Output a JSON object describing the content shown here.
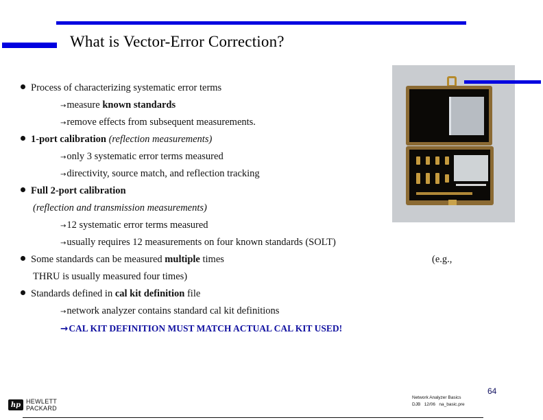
{
  "slide": {
    "title": "What is Vector-Error Correction?",
    "accent_color": "#0000e0",
    "emphasis_color": "#1010a0"
  },
  "bullets": [
    {
      "text": "Process of characterizing systematic error terms"
    },
    {
      "sub_prefix": "measure ",
      "sub_bold": "known standards"
    },
    {
      "text": "remove effects from subsequent measurements."
    },
    {
      "bold": "1-port calibration",
      "italic": " (reflection measurements)"
    },
    {
      "text": "only 3 systematic error terms measured"
    },
    {
      "text": "directivity, source match, and reflection tracking"
    },
    {
      "bold": "Full 2-port calibration"
    },
    {
      "italic": "(reflection and transmission measurements)"
    },
    {
      "text": "12 systematic error terms measured"
    },
    {
      "text": "usually requires 12 measurements on four known standards (SOLT)"
    },
    {
      "prefix": "Some standards can be measured ",
      "bold": "multiple",
      "suffix": " times"
    },
    {
      "text": "THRU is usually measured four times)"
    },
    {
      "prefix": "Standards defined in ",
      "bold": "cal kit definition",
      "suffix": " file"
    },
    {
      "text": "network analyzer contains standard cal kit definitions"
    },
    {
      "text": "CAL KIT DEFINITION MUST MATCH ACTUAL CAL KIT USED!"
    }
  ],
  "photo": {
    "caption": "(e.g.,",
    "alt": "calibration kit in wooden case"
  },
  "footer": {
    "logo_mark": "hp",
    "logo_line1": "HEWLETT",
    "logo_line2": "PACKARD",
    "course": "Network Analyzer Basics",
    "meta": "DJB   12/06   na_basic.pre",
    "page_number": "64"
  }
}
